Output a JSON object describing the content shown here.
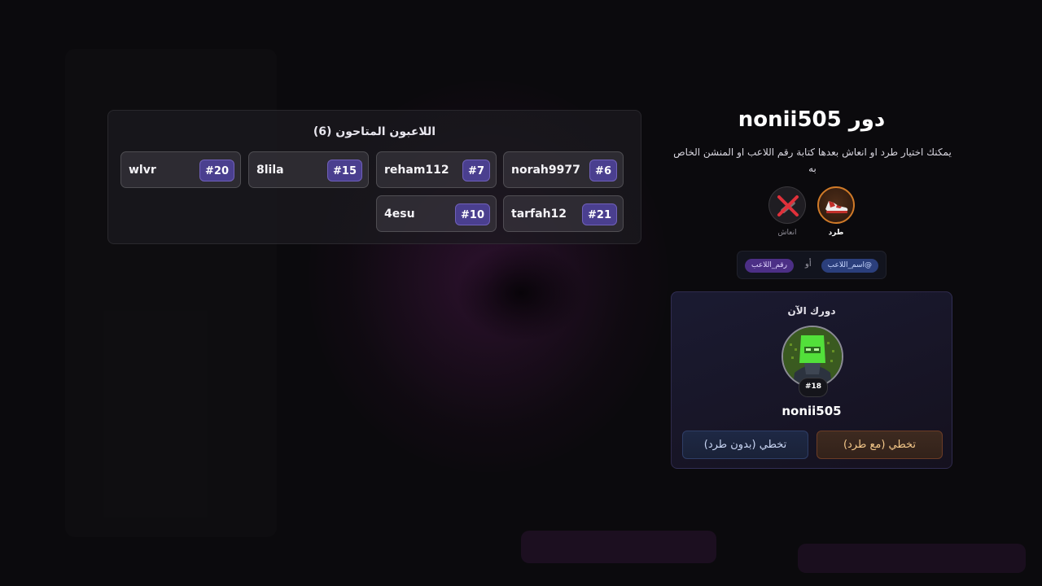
{
  "players_panel": {
    "title": "اللاعبون المتاحون (6)",
    "players": [
      {
        "name": "norah9977",
        "number": "#6"
      },
      {
        "name": "reham112",
        "number": "#7"
      },
      {
        "name": "8lila",
        "number": "#15"
      },
      {
        "name": "wlvr",
        "number": "#20"
      },
      {
        "name": "tarfah12",
        "number": "#21"
      },
      {
        "name": "4esu",
        "number": "#10"
      }
    ]
  },
  "turn": {
    "title": "دور nonii505",
    "instruction": "يمكنك اختيار طرد او انعاش بعدها كتابة رقم اللاعب او المنشن الخاص به"
  },
  "actions": {
    "kick": {
      "label": "طرد",
      "icon": "sneaker-icon",
      "selected": true
    },
    "revive": {
      "label": "انعاش",
      "icon": "syringe-crossed-icon",
      "selected": false
    }
  },
  "mention_hint": {
    "name_tag": "@اسم_اللاعب",
    "or": "أو",
    "number_tag": "رقم_اللاعب"
  },
  "current_turn": {
    "title": "دورك الآن",
    "player_name": "nonii505",
    "player_number": "#18",
    "skip_with_kick": "تخطي (مع طرد)",
    "skip_without_kick": "تخطي (بدون طرد)"
  },
  "colors": {
    "accent_purple": "#4a3f8f",
    "kick_orange": "#d07a28",
    "kick_button_text": "#f5c88a",
    "background": "#0b0a0d"
  }
}
